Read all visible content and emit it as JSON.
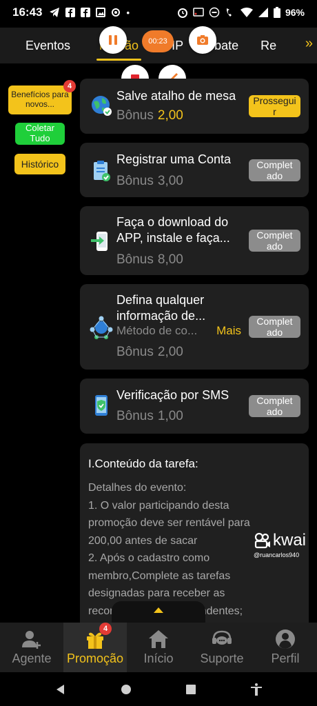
{
  "status_bar": {
    "time": "16:43",
    "battery": "96%"
  },
  "tabs": [
    {
      "label": "Eventos"
    },
    {
      "label": "Missão"
    },
    {
      "label": "VIP"
    },
    {
      "label": "Rebate"
    },
    {
      "label": "Re"
    }
  ],
  "recorder": {
    "timer": "00:23"
  },
  "sidebar": {
    "beneficios": "Benefícios para novos...",
    "beneficios_badge": "4",
    "coletar": "Coletar Tudo",
    "historico": "Histórico"
  },
  "tasks": [
    {
      "title": "Salve atalho de mesa",
      "bonus_label": "Bônus",
      "bonus_value": "2,00",
      "action": "Prosseguir",
      "icon": "globe-icon"
    },
    {
      "title": "Registrar uma Conta",
      "bonus_label": "Bônus",
      "bonus_value": "3,00",
      "action": "Completado",
      "icon": "clipboard-check-icon"
    },
    {
      "title_line1": "Faça o download do",
      "title_line2": "APP, instale e faça...",
      "bonus_label": "Bônus",
      "bonus_value": "8,00",
      "action": "Completado",
      "icon": "phone-download-icon"
    },
    {
      "title_line1": "Defina qualquer",
      "title_line2": "informação de...",
      "sub": "Método de co...",
      "more": "Mais",
      "bonus_label": "Bônus",
      "bonus_value": "2,00",
      "action": "Completado",
      "icon": "network-icon"
    },
    {
      "title": "Verificação por SMS",
      "bonus_label": "Bônus",
      "bonus_value": "1,00",
      "action": "Completado",
      "icon": "phone-shield-icon"
    }
  ],
  "info": {
    "heading": "I.Conteúdo da tarefa:",
    "lines": [
      "Detalhes do evento:",
      "1. O valor participando desta",
      "promoção deve ser rentável para",
      "200,00 antes de sacar",
      "2. Após o cadastro como",
      "membro,Complete as tarefas",
      "designadas para receber as",
      "recompensas correspondentes;"
    ]
  },
  "watermark": {
    "brand": "kwai",
    "user": "@ruancarlos940"
  },
  "bottom_nav": [
    {
      "label": "Agente"
    },
    {
      "label": "Promoção",
      "badge": "4"
    },
    {
      "label": "Início"
    },
    {
      "label": "Suporte"
    },
    {
      "label": "Perfil"
    }
  ],
  "colors": {
    "accent": "#f3c31b",
    "green": "#1fcf3a",
    "badge": "#e43b35",
    "card": "#202020"
  }
}
